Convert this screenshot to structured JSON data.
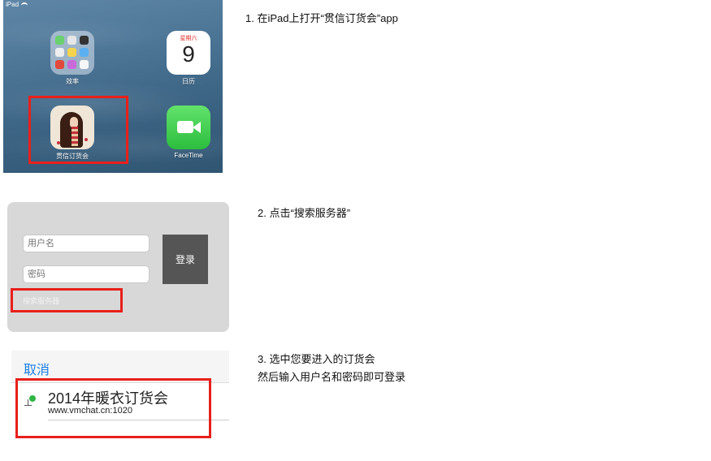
{
  "step1": {
    "status_bar": "iPad",
    "apps": {
      "efficiency": "效率",
      "calendar": "日历",
      "calendar_weekday": "星期六",
      "calendar_date": "9",
      "order_app": "贯信订货会",
      "facetime": "FaceTime"
    },
    "instruction": "1. 在iPad上打开“贯信订货会”app"
  },
  "step2": {
    "username_placeholder": "用户名",
    "password_placeholder": "密码",
    "login_label": "登录",
    "search_server_label": "搜索服务器",
    "instruction": "2. 点击“搜索服务器”"
  },
  "step3": {
    "cancel_label": "取消",
    "event_title": "2014年暖衣订货会",
    "event_url": "www.vmchat.cn:1020",
    "instruction_line1": "3. 选中您要进入的订货会",
    "instruction_line2": "然后输入用户名和密码即可登录"
  },
  "colors": {
    "highlight_box": "#e8201a",
    "cancel_link": "#1a7ee6",
    "login_button": "#555555",
    "status_dot": "#2fb544"
  }
}
